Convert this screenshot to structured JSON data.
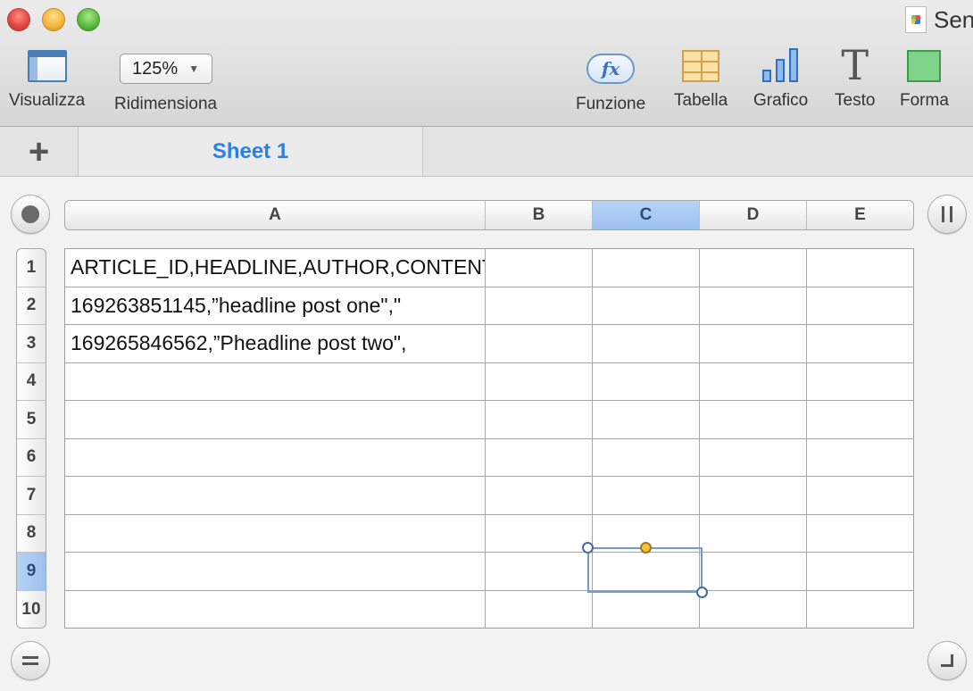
{
  "window": {
    "title": "Sen"
  },
  "toolbar": {
    "view_label": "Visualizza",
    "zoom_value": "125%",
    "zoom_label": "Ridimensiona",
    "function_icon_text": "fx",
    "function_label": "Funzione",
    "table_label": "Tabella",
    "chart_label": "Grafico",
    "text_icon_text": "T",
    "text_label": "Testo",
    "shape_label": "Forma"
  },
  "tabs": {
    "add_symbol": "+",
    "sheets": [
      "Sheet 1"
    ],
    "active_color": "#2f7fe0"
  },
  "sheet": {
    "columns": [
      "A",
      "B",
      "C",
      "D",
      "E"
    ],
    "selected_column": "C",
    "rows": [
      "1",
      "2",
      "3",
      "4",
      "5",
      "6",
      "7",
      "8",
      "9",
      "10"
    ],
    "selected_row": "9",
    "cells": [
      [
        "ARTICLE_ID,HEADLINE,AUTHOR,CONTENT",
        "",
        "",
        "",
        ""
      ],
      [
        "169263851145,”headline post one\",\"",
        "",
        "",
        "",
        ""
      ],
      [
        "169265846562,”Pheadline post two\",",
        "",
        "",
        "",
        ""
      ],
      [
        "",
        "",
        "",
        "",
        ""
      ],
      [
        "",
        "",
        "",
        "",
        ""
      ],
      [
        "",
        "",
        "",
        "",
        ""
      ],
      [
        "",
        "",
        "",
        "",
        ""
      ],
      [
        "",
        "",
        "",
        "",
        ""
      ],
      [
        "",
        "",
        "",
        "",
        ""
      ],
      [
        "",
        "",
        "",
        "",
        ""
      ]
    ],
    "selection_color": "#6f9ad4",
    "header_highlight_color": "#9cc1ef"
  }
}
